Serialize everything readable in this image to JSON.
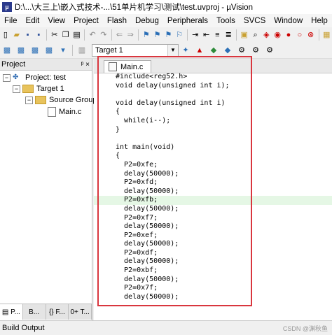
{
  "window": {
    "title": "D:\\...\\大三上\\嵌入式技术-...\\51单片机学习\\测试\\test.uvproj - µVision"
  },
  "menu": [
    "File",
    "Edit",
    "View",
    "Project",
    "Flash",
    "Debug",
    "Peripherals",
    "Tools",
    "SVCS",
    "Window",
    "Help"
  ],
  "toolbar": {
    "target": "Target 1"
  },
  "project_panel": {
    "title": "Project",
    "pin": "ᵖ ×",
    "tree": {
      "project": "Project: test",
      "target": "Target 1",
      "group": "Source Group",
      "file": "Main.c"
    },
    "tabs": [
      "B...",
      "{} F...",
      "0+ T..."
    ]
  },
  "editor": {
    "tab": "Main.c",
    "lines": [
      "#include<reg52.h>",
      "void delay(unsigned int i);",
      "",
      "void delay(unsigned int i)",
      "{",
      "  while(i--);",
      "}",
      "",
      "int main(void)",
      "{",
      "  P2=0xfe;",
      "  delay(50000);",
      "  P2=0xfd;",
      "  delay(50000);",
      "  P2=0xfb;",
      "  delay(50000);",
      "  P2=0xf7;",
      "  delay(50000);",
      "  P2=0xef;",
      "  delay(50000);",
      "  P2=0xdf;",
      "  delay(50000);",
      "  P2=0xbf;",
      "  delay(50000);",
      "  P2=0x7f;",
      "  delay(50000);"
    ]
  },
  "build_output": {
    "label": "Build Output"
  },
  "watermark": "CSDN @渊秋鱼"
}
